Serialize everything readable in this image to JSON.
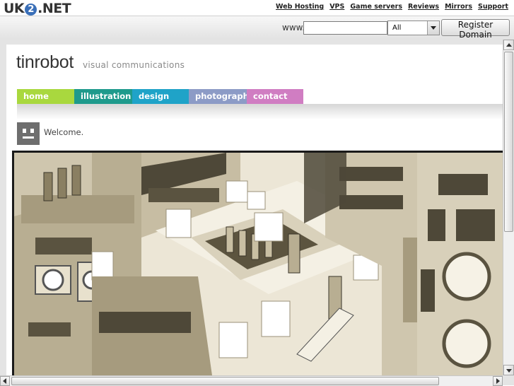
{
  "host": {
    "logo_left": "UK",
    "logo_digit": "2",
    "logo_right": ".NET",
    "links": [
      "Web Hosting",
      "VPS",
      "Game servers",
      "Reviews",
      "Mirrors",
      "Support"
    ]
  },
  "domain_search": {
    "prefix": "www.",
    "input_value": "",
    "tld_selected": "All",
    "register_label": "Register Domain"
  },
  "site": {
    "brand": "tinrobot",
    "tagline": "visual communications",
    "nav": [
      {
        "label": "home",
        "color": "#a9d83e"
      },
      {
        "label": "illustration",
        "color": "#1e9a8c"
      },
      {
        "label": "design",
        "color": "#1fa3c8"
      },
      {
        "label": "photography",
        "color": "#8c9bc6"
      },
      {
        "label": "contact",
        "color": "#d07dc2"
      }
    ],
    "welcome": "Welcome.",
    "avatar_icon": "robot-face-icon",
    "artwork": "isometric-robot-city-illustration"
  }
}
